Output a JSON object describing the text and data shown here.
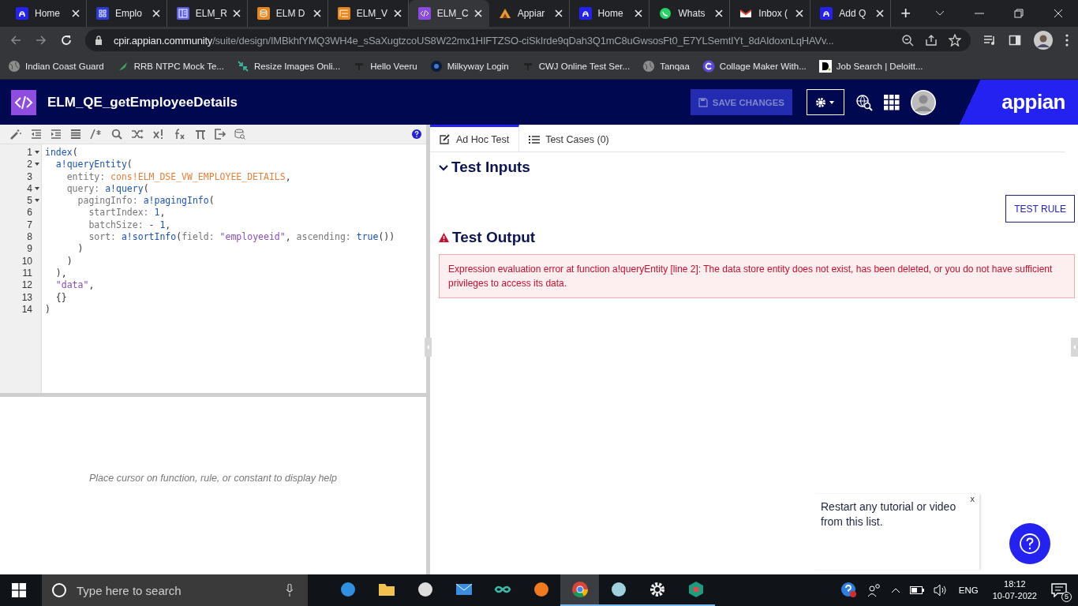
{
  "browser": {
    "tabs": [
      {
        "label": "Home",
        "kind": "appian",
        "selected": false
      },
      {
        "label": "Emplo",
        "kind": "grid",
        "selected": false
      },
      {
        "label": "ELM_R",
        "kind": "form",
        "selected": false
      },
      {
        "label": "ELM D",
        "kind": "database",
        "selected": false
      },
      {
        "label": "ELM_V",
        "kind": "record",
        "selected": false
      },
      {
        "label": "ELM_C",
        "kind": "expression",
        "selected": true
      },
      {
        "label": "Appiar",
        "kind": "community",
        "selected": false
      },
      {
        "label": "Home",
        "kind": "appian",
        "selected": false
      },
      {
        "label": "Whats",
        "kind": "whatsapp",
        "selected": false
      },
      {
        "label": "Inbox (",
        "kind": "gmail",
        "selected": false
      },
      {
        "label": "Add Q",
        "kind": "appian",
        "selected": false
      }
    ],
    "new_tab": "+",
    "address": {
      "domain": "cpir.appian.community",
      "path": "/suite/design/IMBkhfYMQ3WH4e_sSaXugtzcoUS8W22mx1HIFTZSO-ciSkIrde9qDah3Q1mC8uGwsosFt0_E7YLSemtIYt_8dAIdoxnLqHAVv..."
    },
    "bookmarks": [
      {
        "label": "Indian Coast Guard",
        "kind": "globe"
      },
      {
        "label": "RRB NTPC Mock Te...",
        "kind": "rocket"
      },
      {
        "label": "Resize Images Onli...",
        "kind": "resize"
      },
      {
        "label": "Hello Veeru",
        "kind": "bar"
      },
      {
        "label": "Milkyway Login",
        "kind": "planet"
      },
      {
        "label": "CWJ Online Test Ser...",
        "kind": "bar"
      },
      {
        "label": "Tanqaa",
        "kind": "globe"
      },
      {
        "label": "Collage Maker With...",
        "kind": "circle"
      },
      {
        "label": "Job Search | Deloitt...",
        "kind": "deloitte"
      }
    ]
  },
  "app": {
    "title": "ELM_QE_getEmployeeDetails",
    "save_button": {
      "label": "SAVE CHANGES",
      "disabled": true
    },
    "logo": "appian"
  },
  "editor": {
    "lines": [
      {
        "number": "1",
        "foldable": true,
        "tokens": [
          {
            "kind": "fn",
            "text": "index"
          },
          {
            "kind": "plain",
            "text": "("
          }
        ]
      },
      {
        "number": "2",
        "foldable": true,
        "tokens": [
          {
            "kind": "fn",
            "text": "  a!queryEntity"
          },
          {
            "kind": "plain",
            "text": "("
          }
        ]
      },
      {
        "number": "3",
        "foldable": false,
        "tokens": [
          {
            "kind": "key",
            "text": "    entity: "
          },
          {
            "kind": "const",
            "text": "cons!ELM_DSE_VW_EMPLOYEE_DETAILS"
          },
          {
            "kind": "plain",
            "text": ","
          }
        ]
      },
      {
        "number": "4",
        "foldable": true,
        "tokens": [
          {
            "kind": "key",
            "text": "    query: "
          },
          {
            "kind": "fn",
            "text": "a!query"
          },
          {
            "kind": "plain",
            "text": "("
          }
        ]
      },
      {
        "number": "5",
        "foldable": true,
        "tokens": [
          {
            "kind": "key",
            "text": "      pagingInfo: "
          },
          {
            "kind": "fn",
            "text": "a!pagingInfo"
          },
          {
            "kind": "plain",
            "text": "("
          }
        ]
      },
      {
        "number": "6",
        "foldable": false,
        "tokens": [
          {
            "kind": "key",
            "text": "        startIndex: "
          },
          {
            "kind": "num",
            "text": "1"
          },
          {
            "kind": "plain",
            "text": ","
          }
        ]
      },
      {
        "number": "7",
        "foldable": false,
        "tokens": [
          {
            "kind": "key",
            "text": "        batchSize: "
          },
          {
            "kind": "plain",
            "text": "- "
          },
          {
            "kind": "num",
            "text": "1"
          },
          {
            "kind": "plain",
            "text": ","
          }
        ]
      },
      {
        "number": "8",
        "foldable": false,
        "tokens": [
          {
            "kind": "key",
            "text": "        sort: "
          },
          {
            "kind": "fn",
            "text": "a!sortInfo"
          },
          {
            "kind": "plain",
            "text": "("
          },
          {
            "kind": "key",
            "text": "field: "
          },
          {
            "kind": "str",
            "text": "\"employeeid\""
          },
          {
            "kind": "plain",
            "text": ", "
          },
          {
            "kind": "key",
            "text": "ascending: "
          },
          {
            "kind": "fn",
            "text": "true"
          },
          {
            "kind": "plain",
            "text": "())"
          }
        ]
      },
      {
        "number": "9",
        "foldable": false,
        "tokens": [
          {
            "kind": "plain",
            "text": "      )"
          }
        ]
      },
      {
        "number": "10",
        "foldable": false,
        "tokens": [
          {
            "kind": "plain",
            "text": "    )"
          }
        ]
      },
      {
        "number": "11",
        "foldable": false,
        "tokens": [
          {
            "kind": "plain",
            "text": "  ),"
          }
        ]
      },
      {
        "number": "12",
        "foldable": false,
        "tokens": [
          {
            "kind": "str",
            "text": "  \"data\""
          },
          {
            "kind": "plain",
            "text": ","
          }
        ]
      },
      {
        "number": "13",
        "foldable": false,
        "tokens": [
          {
            "kind": "plain",
            "text": "  {}"
          }
        ]
      },
      {
        "number": "14",
        "foldable": false,
        "tokens": [
          {
            "kind": "plain",
            "text": ")"
          }
        ]
      }
    ],
    "help_text": "Place cursor on function, rule, or constant to display help"
  },
  "test_panel": {
    "tabs": [
      {
        "label": "Ad Hoc Test",
        "kind": "edit",
        "selected": true
      },
      {
        "label": "Test Cases (0)",
        "kind": "list",
        "selected": false
      }
    ],
    "inputs": {
      "title": "Test Inputs",
      "expanded": true
    },
    "test_button": "TEST RULE",
    "output": {
      "title": "Test Output",
      "error": true,
      "message": "Expression evaluation error at function a!queryEntity [line 2]: The data store entity does not exist, has been deleted, or you do not have sufficient privileges to access its data."
    }
  },
  "tutorial_popup": {
    "text": "Restart any tutorial or video from this list.",
    "close": "x"
  },
  "taskbar": {
    "search": {
      "placeholder": "Type here to search"
    },
    "apps": [
      {
        "kind": "edge",
        "running": false,
        "selected": false
      },
      {
        "kind": "folder",
        "running": false,
        "selected": false
      },
      {
        "kind": "store",
        "running": false,
        "selected": false
      },
      {
        "kind": "mail",
        "running": false,
        "selected": false
      },
      {
        "kind": "infinity",
        "running": false,
        "selected": false
      },
      {
        "kind": "firefox",
        "running": false,
        "selected": false
      },
      {
        "kind": "chrome",
        "running": true,
        "selected": true
      },
      {
        "kind": "notes",
        "running": true,
        "selected": false
      },
      {
        "kind": "gear",
        "running": true,
        "selected": false
      },
      {
        "kind": "cube",
        "running": true,
        "selected": false
      }
    ],
    "language": "ENG",
    "time": "18:12",
    "date": "10-07-2022",
    "notifications": "5"
  }
}
